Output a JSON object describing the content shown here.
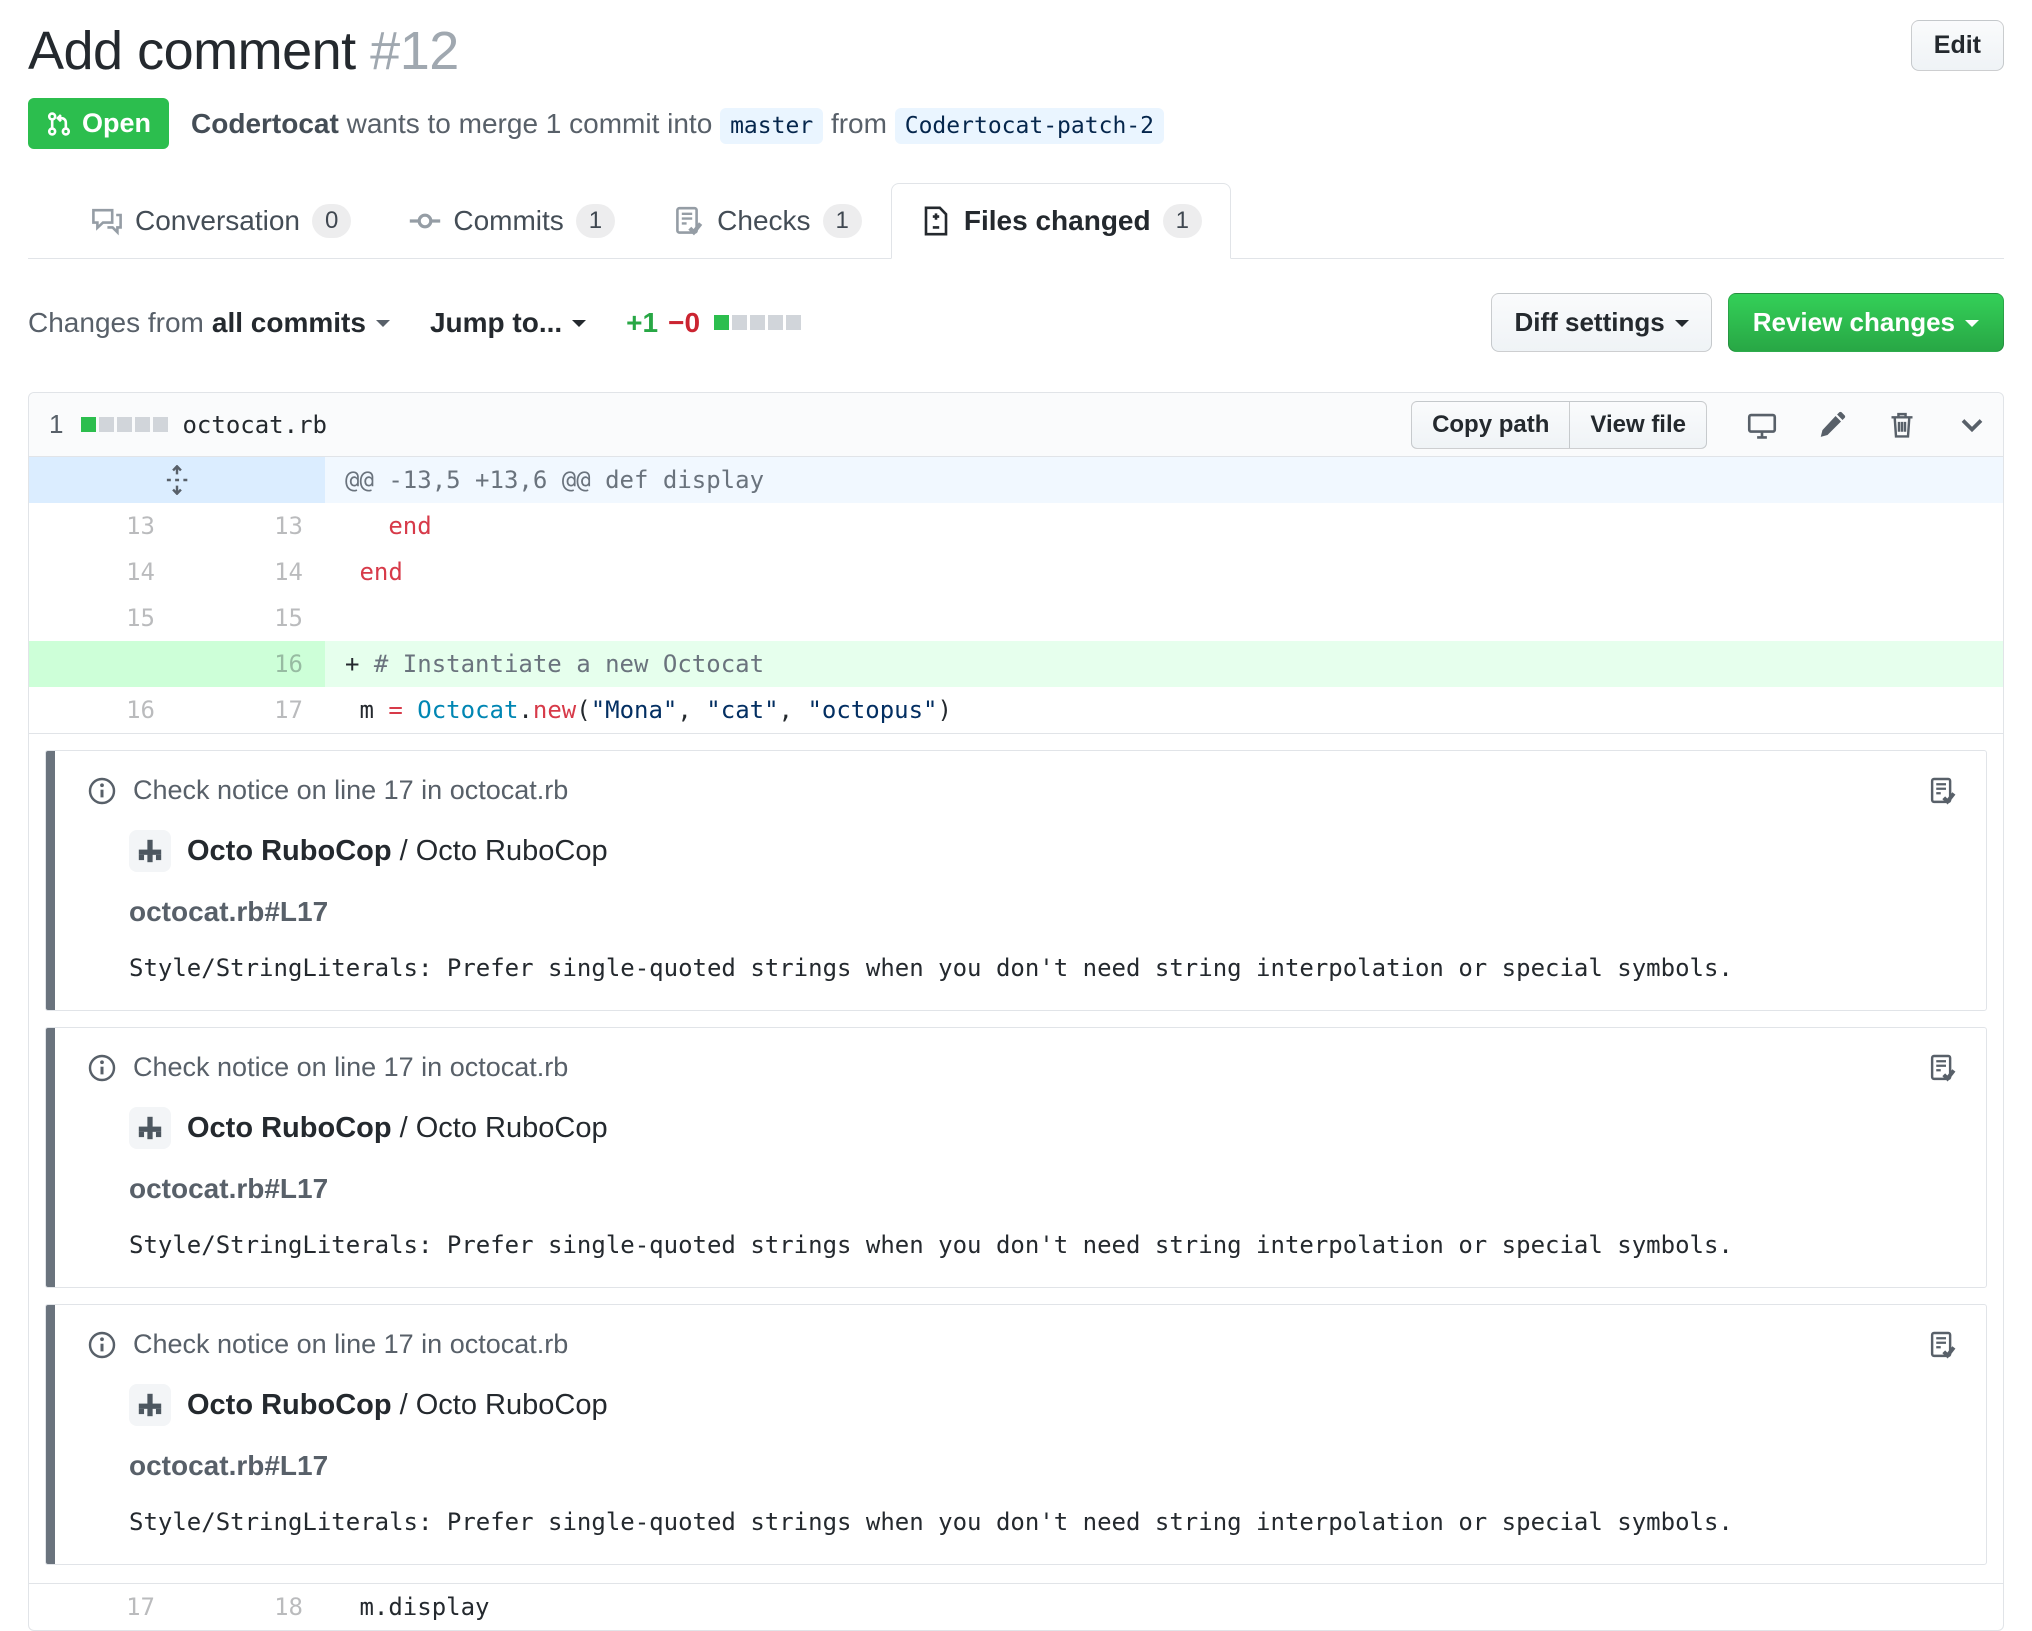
{
  "page": {
    "title": "Add comment",
    "number": "#12",
    "edit_button": "Edit"
  },
  "status": {
    "state": "Open",
    "author": "Codertocat",
    "action": " wants to merge 1 commit into ",
    "base_branch": "master",
    "from_word": "from",
    "head_branch": "Codertocat-patch-2"
  },
  "tabs": [
    {
      "label": "Conversation",
      "count": "0",
      "icon": "comment-discussion-icon",
      "active": false
    },
    {
      "label": "Commits",
      "count": "1",
      "icon": "git-commit-icon",
      "active": false
    },
    {
      "label": "Checks",
      "count": "1",
      "icon": "checklist-icon",
      "active": false
    },
    {
      "label": "Files changed",
      "count": "1",
      "icon": "file-diff-icon",
      "active": true
    }
  ],
  "toolbar": {
    "changes_from_label": "Changes from",
    "changes_from_value": "all commits",
    "jump_to": "Jump to...",
    "additions": "+1",
    "deletions": "−0",
    "diffstat_blocks": [
      "added",
      "neutral",
      "neutral",
      "neutral",
      "neutral"
    ],
    "diff_settings_button": "Diff settings",
    "review_changes_button": "Review changes"
  },
  "file": {
    "changed_files_count": "1",
    "name": "octocat.rb",
    "diffstat_blocks": [
      "added",
      "neutral",
      "neutral",
      "neutral",
      "neutral"
    ],
    "copy_path_button": "Copy path",
    "view_file_button": "View file",
    "action_icons": [
      "display-rich-diff-icon",
      "edit-file-icon",
      "delete-file-icon",
      "collapse-chevron-icon"
    ]
  },
  "diff": {
    "hunk_header": "@@ -13,5 +13,6 @@ def display",
    "rows": [
      {
        "old": "13",
        "new": "13",
        "type": "context",
        "segments": [
          {
            "text": "   ",
            "tok": "plain"
          },
          {
            "text": "end",
            "tok": "keyword"
          }
        ]
      },
      {
        "old": "14",
        "new": "14",
        "type": "context",
        "segments": [
          {
            "text": " ",
            "tok": "plain"
          },
          {
            "text": "end",
            "tok": "keyword"
          }
        ]
      },
      {
        "old": "15",
        "new": "15",
        "type": "context",
        "segments": [
          {
            "text": "",
            "tok": "plain"
          }
        ]
      },
      {
        "old": "",
        "new": "16",
        "type": "addition",
        "segments": [
          {
            "text": "+ ",
            "tok": "plain"
          },
          {
            "text": "# Instantiate a new Octocat",
            "tok": "comment"
          }
        ]
      },
      {
        "old": "16",
        "new": "17",
        "type": "context",
        "segments": [
          {
            "text": " m ",
            "tok": "plain"
          },
          {
            "text": "=",
            "tok": "keyword"
          },
          {
            "text": " ",
            "tok": "plain"
          },
          {
            "text": "Octocat",
            "tok": "constant"
          },
          {
            "text": ".",
            "tok": "plain"
          },
          {
            "text": "new",
            "tok": "keyword"
          },
          {
            "text": "(",
            "tok": "plain"
          },
          {
            "text": "\"Mona\"",
            "tok": "string"
          },
          {
            "text": ", ",
            "tok": "plain"
          },
          {
            "text": "\"cat\"",
            "tok": "string"
          },
          {
            "text": ", ",
            "tok": "plain"
          },
          {
            "text": "\"octopus\"",
            "tok": "string"
          },
          {
            "text": ")",
            "tok": "plain"
          }
        ]
      }
    ],
    "bottom_row": {
      "old": "17",
      "new": "18",
      "segments": [
        {
          "text": " m.display",
          "tok": "plain"
        }
      ]
    }
  },
  "notices": [
    {
      "title": "Check notice on line 17 in octocat.rb",
      "app_name": "Octo RuboCop",
      "separator": " / ",
      "context": "Octo RuboCop",
      "location": "octocat.rb#L17",
      "message": "Style/StringLiterals: Prefer single-quoted strings when you don't need string interpolation or special symbols.",
      "corner_icon": "checklist-icon"
    },
    {
      "title": "Check notice on line 17 in octocat.rb",
      "app_name": "Octo RuboCop",
      "separator": " / ",
      "context": "Octo RuboCop",
      "location": "octocat.rb#L17",
      "message": "Style/StringLiterals: Prefer single-quoted strings when you don't need string interpolation or special symbols.",
      "corner_icon": "checklist-icon"
    },
    {
      "title": "Check notice on line 17 in octocat.rb",
      "app_name": "Octo RuboCop",
      "separator": " / ",
      "context": "Octo RuboCop",
      "location": "octocat.rb#L17",
      "message": "Style/StringLiterals: Prefer single-quoted strings when you don't need string interpolation or special symbols.",
      "corner_icon": "checklist-icon"
    }
  ],
  "colors": {
    "open_badge_green": "#2cbe4e",
    "review_button_green": "#28a745",
    "addition_text_green": "#28a745",
    "deletion_text_red": "#cb2431",
    "branch_label_bg": "#eaf5ff",
    "hunk_gutter_bg": "#dbedff",
    "hunk_code_bg": "#f1f8ff",
    "added_gutter_bg": "#cdffd8",
    "added_code_bg": "#e6ffed",
    "syntax_keyword": "#d73a49",
    "syntax_constant": "#0086b3",
    "syntax_string": "#032f62",
    "syntax_comment": "#6a737d"
  }
}
